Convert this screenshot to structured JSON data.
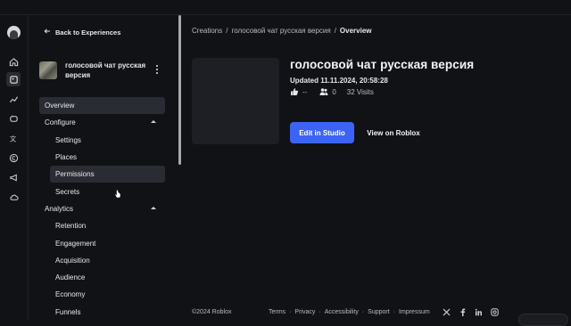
{
  "sidebar": {
    "back_label": "Back to Experiences",
    "experience_name": "голосовой чат русская версия",
    "nav": [
      {
        "label": "Overview"
      },
      {
        "label": "Configure"
      },
      {
        "label": "Settings"
      },
      {
        "label": "Places"
      },
      {
        "label": "Permissions"
      },
      {
        "label": "Secrets"
      },
      {
        "label": "Analytics"
      },
      {
        "label": "Retention"
      },
      {
        "label": "Engagement"
      },
      {
        "label": "Acquisition"
      },
      {
        "label": "Audience"
      },
      {
        "label": "Economy"
      },
      {
        "label": "Funnels"
      }
    ]
  },
  "breadcrumb": {
    "root": "Creations",
    "sep": "/",
    "experience": "голосовой чат русская версия",
    "current": "Overview"
  },
  "header": {
    "title": "голосовой чат русская версия",
    "updated": "Updated 11.11.2024, 20:58:28",
    "likes": "--",
    "players": "0",
    "visits": "32 Visits"
  },
  "actions": {
    "edit": "Edit in Studio",
    "view": "View on Roblox"
  },
  "footer": {
    "copyright": "©2024 Roblox",
    "links": [
      "Terms",
      "·",
      "Privacy",
      "·",
      "Accessibility",
      "·",
      "Support",
      "·",
      "Impressum"
    ]
  },
  "colors": {
    "background": "#111216",
    "accent": "#3c64f4",
    "active": "#2a2c33"
  }
}
